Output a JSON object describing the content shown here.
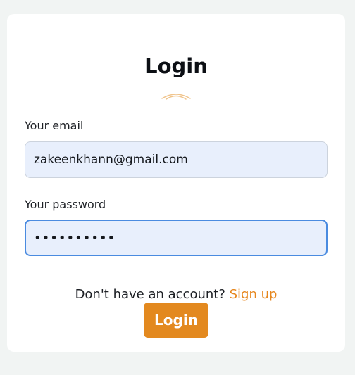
{
  "form": {
    "title": "Login",
    "email_label": "Your email",
    "email_value": "zakeenkhann@gmail.com",
    "password_label": "Your password",
    "password_value": "••••••••••",
    "signup_prompt": "Don't have an account?",
    "signup_link": "Sign up",
    "login_button": "Login"
  },
  "colors": {
    "accent": "#e3891f",
    "link": "#e6861d",
    "input_bg": "#e8effc",
    "focus_border": "#4a8be0",
    "page_bg": "#f1f4f3"
  },
  "icons": {
    "title_decoration": "arc-decoration-icon"
  }
}
